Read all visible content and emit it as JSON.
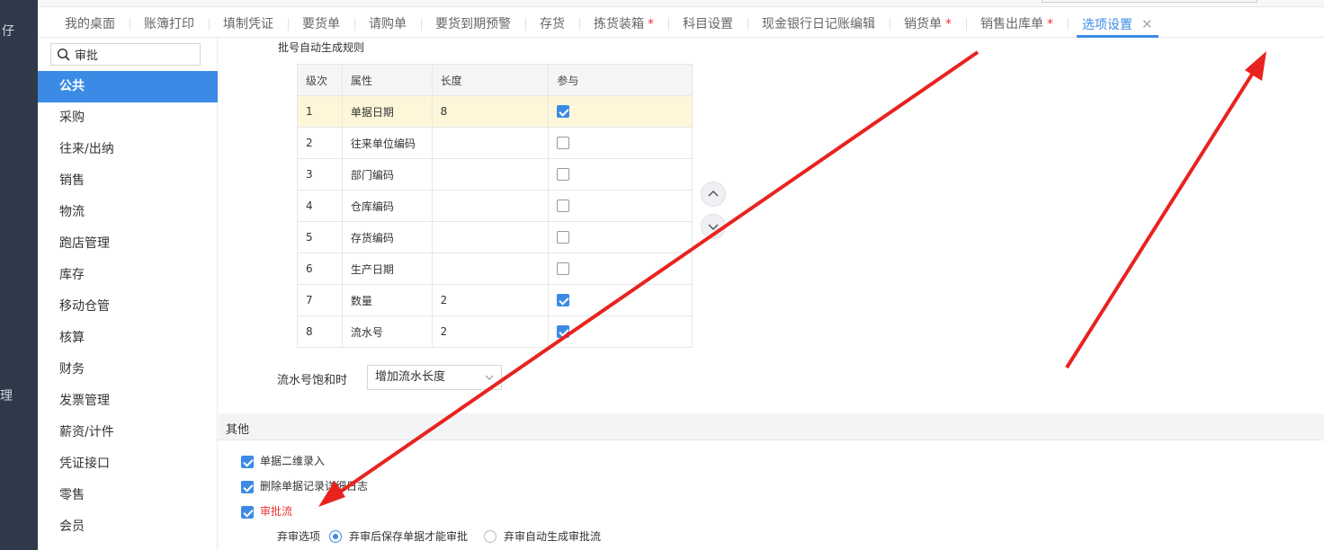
{
  "left_rail": {
    "frag_top": "仔",
    "frag_mid": "理"
  },
  "tabs": [
    {
      "label": "我的桌面",
      "modified": ""
    },
    {
      "label": "账簿打印",
      "modified": ""
    },
    {
      "label": "填制凭证",
      "modified": ""
    },
    {
      "label": "要货单",
      "modified": ""
    },
    {
      "label": "请购单",
      "modified": ""
    },
    {
      "label": "要货到期预警",
      "modified": ""
    },
    {
      "label": "存货",
      "modified": ""
    },
    {
      "label": "拣货装箱",
      "modified": "*"
    },
    {
      "label": "科目设置",
      "modified": ""
    },
    {
      "label": "现金银行日记账编辑",
      "modified": ""
    },
    {
      "label": "销货单",
      "modified": "*"
    },
    {
      "label": "销售出库单",
      "modified": "*"
    },
    {
      "label": "选项设置",
      "modified": "",
      "close": "✕"
    }
  ],
  "sidebar": {
    "search_value": "审批",
    "items": [
      "公共",
      "采购",
      "往来/出纳",
      "销售",
      "物流",
      "跑店管理",
      "库存",
      "移动仓管",
      "核算",
      "财务",
      "发票管理",
      "薪资/计件",
      "凭证接口",
      "零售",
      "会员"
    ]
  },
  "batch_rules": {
    "title": "批号自动生成规则",
    "headers": [
      "级次",
      "属性",
      "长度",
      "参与"
    ],
    "rows": [
      {
        "level": "1",
        "attr": "单据日期",
        "length": "8",
        "checked": true
      },
      {
        "level": "2",
        "attr": "往来单位编码",
        "length": "",
        "checked": false
      },
      {
        "level": "3",
        "attr": "部门编码",
        "length": "",
        "checked": false
      },
      {
        "level": "4",
        "attr": "仓库编码",
        "length": "",
        "checked": false
      },
      {
        "level": "5",
        "attr": "存货编码",
        "length": "",
        "checked": false
      },
      {
        "level": "6",
        "attr": "生产日期",
        "length": "",
        "checked": false
      },
      {
        "level": "7",
        "attr": "数量",
        "length": "2",
        "checked": true
      },
      {
        "level": "8",
        "attr": "流水号",
        "length": "2",
        "checked": true
      }
    ],
    "up_icon": "^",
    "down_icon": "v"
  },
  "saturation": {
    "label": "流水号饱和时",
    "value": "增加流水长度"
  },
  "other": {
    "title": "其他",
    "options": [
      {
        "label": "单据二维录入",
        "checked": true
      },
      {
        "label": "删除单据记录详细日志",
        "checked": true
      },
      {
        "label": "审批流",
        "checked": true
      }
    ],
    "abandon_label": "弃审选项",
    "abandon_opt1": "弃审后保存单据才能审批",
    "abandon_opt2": "弃审自动生成审批流"
  },
  "colors": {
    "accent": "#3b8be6",
    "annotation_arrow": "#e8231f",
    "selected_row": "#fdf6d8"
  }
}
